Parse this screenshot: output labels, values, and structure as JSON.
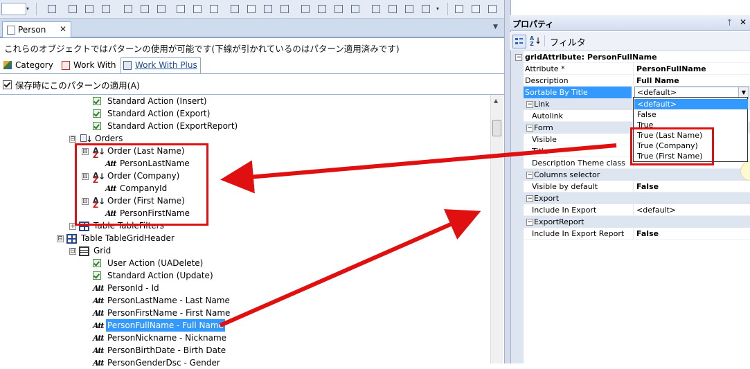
{
  "document_tab": {
    "label": "Person",
    "close": "✕"
  },
  "info_text": "これらのオブジェクトではパターンの使用が可能です(下線が引かれているのはパターン適用済みです)",
  "pattern_tabs": [
    {
      "label": "Category"
    },
    {
      "label": "Work With"
    },
    {
      "label": "Work With Plus"
    }
  ],
  "apply_checkbox": {
    "label": "保存時にこのパターンの適用(A)",
    "checked": true
  },
  "tree": [
    {
      "text": "Standard Action (Insert)",
      "icon": "action-icon"
    },
    {
      "text": "Standard Action (Export)",
      "icon": "action-icon"
    },
    {
      "text": "Standard Action (ExportReport)",
      "icon": "action-icon"
    },
    {
      "text": "Orders",
      "icon": "orders-icon"
    },
    {
      "text": "Order (Last Name)",
      "icon": "sort-az-icon"
    },
    {
      "text": "PersonLastName",
      "icon": "attribute-icon"
    },
    {
      "text": "Order (Company)",
      "icon": "sort-az-icon"
    },
    {
      "text": "CompanyId",
      "icon": "attribute-icon"
    },
    {
      "text": "Order (First Name)",
      "icon": "sort-az-icon"
    },
    {
      "text": "PersonFirstName",
      "icon": "attribute-icon"
    },
    {
      "text": "Table TableFilters",
      "icon": "table-icon"
    },
    {
      "text": "Table TableGridHeader",
      "icon": "table-icon"
    },
    {
      "text": "Grid",
      "icon": "grid-icon"
    },
    {
      "text": "User Action (UADelete)",
      "icon": "action-icon"
    },
    {
      "text": "Standard Action (Update)",
      "icon": "action-icon"
    },
    {
      "text": "PersonId - Id",
      "icon": "attribute-icon"
    },
    {
      "text": "PersonLastName - Last Name",
      "icon": "attribute-icon"
    },
    {
      "text": "PersonFirstName - First Name",
      "icon": "attribute-icon"
    },
    {
      "text": "PersonFullName - Full Name",
      "icon": "attribute-icon",
      "selected": true
    },
    {
      "text": "PersonNickname - Nickname",
      "icon": "attribute-icon"
    },
    {
      "text": "PersonBirthDate - Birth Date",
      "icon": "attribute-icon"
    },
    {
      "text": "PersonGenderDsc - Gender",
      "icon": "attribute-icon"
    }
  ],
  "glyphs": {
    "attribute": "Att",
    "sort_a": "A",
    "sort_z": "Z",
    "down_arrow": "↓",
    "tree_expander": "⊟",
    "prop_expander": "−"
  },
  "properties_panel": {
    "title": "プロパティ",
    "pin": "ᛘ",
    "close": "✕",
    "filter_label": "フィルタ",
    "rows": [
      {
        "name": "gridAttribute: PersonFullName",
        "value": "",
        "kind": "header"
      },
      {
        "name": "Attribute *",
        "value": "PersonFullName",
        "bold": true
      },
      {
        "name": "Description",
        "value": "Full Name",
        "bold": true
      },
      {
        "name": "Sortable By Title",
        "value": "<default>",
        "selected": true
      },
      {
        "name": "Link",
        "value": "",
        "kind": "category"
      },
      {
        "name": "Autolink",
        "value": ""
      },
      {
        "name": "Form",
        "value": "",
        "kind": "category"
      },
      {
        "name": "Visible",
        "value": ""
      },
      {
        "name": "Title",
        "value": ""
      },
      {
        "name": "Description Theme class",
        "value": ""
      },
      {
        "name": "Columns selector",
        "value": "",
        "kind": "category"
      },
      {
        "name": "Visible by default",
        "value": "False",
        "bold": true
      },
      {
        "name": "Export",
        "value": "",
        "kind": "category"
      },
      {
        "name": "Include In Export",
        "value": "<default>"
      },
      {
        "name": "ExportReport",
        "value": "",
        "kind": "category"
      },
      {
        "name": "Include In Export Report",
        "value": "False",
        "bold": true
      }
    ],
    "dropdown_options": [
      "<default>",
      "False",
      "True",
      "True (Last Name)",
      "True (Company)",
      "True (First Name)"
    ],
    "dropdown_selected_index": 0
  },
  "colors": {
    "highlight_box": "#e01010",
    "selection": "#3399ff",
    "arrow": "#e01010"
  }
}
